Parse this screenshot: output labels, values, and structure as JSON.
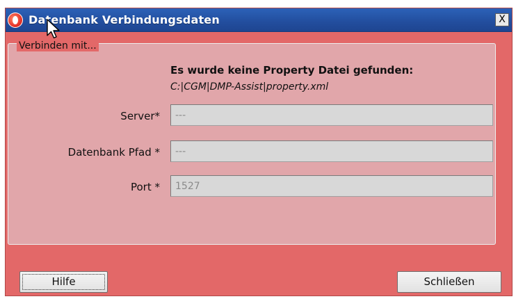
{
  "window": {
    "title": "Datenbank Verbindungsdaten",
    "close_glyph": "X"
  },
  "group": {
    "legend": "Verbinden mit..."
  },
  "message": {
    "title": "Es wurde keine Property Datei gefunden:",
    "path": "C:|CGM|DMP-Assist|property.xml"
  },
  "fields": {
    "server": {
      "label": "Server*",
      "value": "---"
    },
    "db_path": {
      "label": "Datenbank Pfad *",
      "value": "---"
    },
    "port": {
      "label": "Port *",
      "value": "1527"
    }
  },
  "buttons": {
    "help": "Hilfe",
    "close": "Schließen"
  },
  "colors": {
    "window_bg": "#e36868",
    "group_bg": "#e1a6aa",
    "titlebar": "#234fa0"
  }
}
